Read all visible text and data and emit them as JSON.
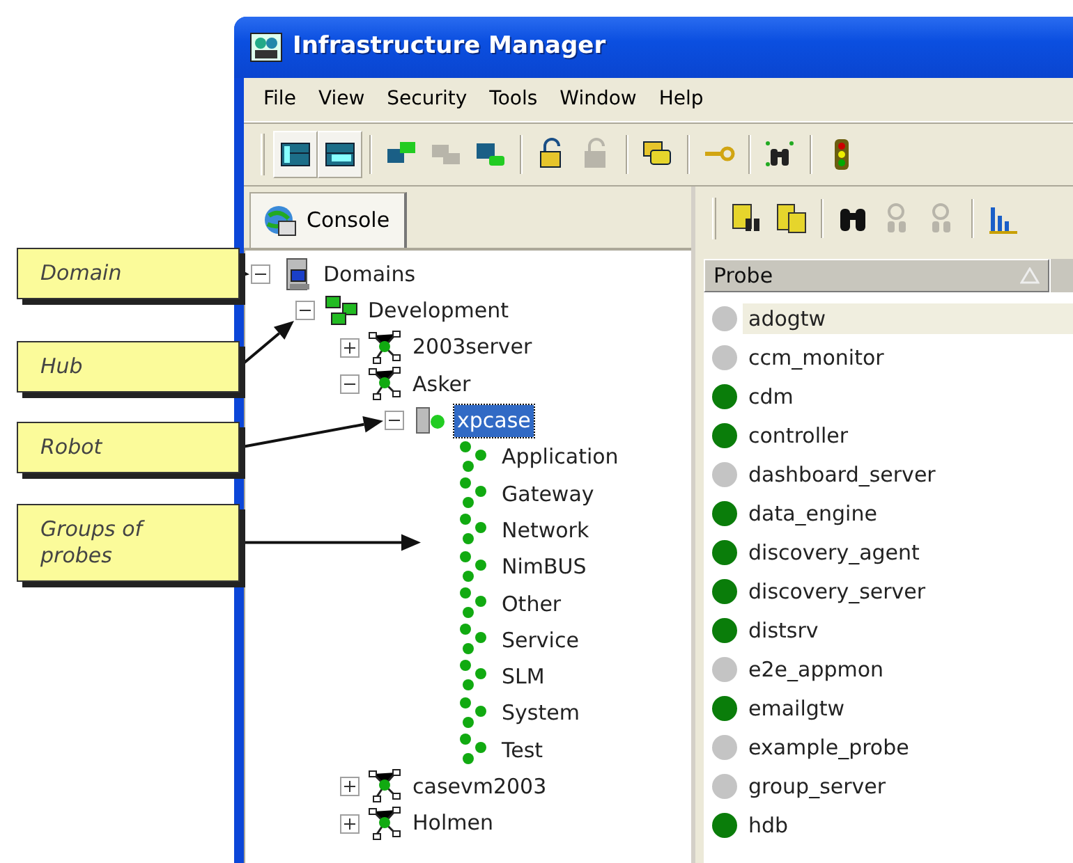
{
  "window": {
    "title": "Infrastructure Manager"
  },
  "menu": [
    "File",
    "View",
    "Security",
    "Tools",
    "Window",
    "Help"
  ],
  "main_toolbar": [
    [
      {
        "disabled": false,
        "pressed": true
      },
      {
        "disabled": false,
        "pressed": true
      }
    ],
    [
      {
        "disabled": false,
        "pressed": false
      },
      {
        "disabled": true,
        "pressed": false
      },
      {
        "disabled": false,
        "pressed": false
      }
    ],
    [
      {
        "disabled": false,
        "pressed": false
      },
      {
        "disabled": true,
        "pressed": false
      }
    ],
    [
      {
        "disabled": false,
        "pressed": false
      }
    ],
    [
      {
        "disabled": false,
        "pressed": false
      }
    ],
    [
      {
        "disabled": false,
        "pressed": false
      }
    ],
    [
      {
        "disabled": false,
        "pressed": false
      }
    ]
  ],
  "tabs": [
    {
      "label": "Console",
      "selected": true
    }
  ],
  "tree": [
    {
      "label": "Domains",
      "kind": "domain",
      "expanded": true,
      "selected": false,
      "callout": "Domain",
      "children": [
        {
          "label": "Development",
          "kind": "hub",
          "expanded": true,
          "selected": false,
          "callout": "Hub",
          "children": [
            {
              "label": "2003server",
              "kind": "server",
              "expanded": false,
              "selected": false
            },
            {
              "label": "Asker",
              "kind": "server",
              "expanded": true,
              "selected": false,
              "children": [
                {
                  "label": "xpcase",
                  "kind": "robot",
                  "expanded": true,
                  "selected": true,
                  "callout": "Robot",
                  "children": [
                    {
                      "label": "Application",
                      "kind": "group",
                      "selected": false
                    },
                    {
                      "label": "Gateway",
                      "kind": "group",
                      "selected": false
                    },
                    {
                      "label": "Network",
                      "kind": "group",
                      "selected": false,
                      "callout": "Groups of probes"
                    },
                    {
                      "label": "NimBUS",
                      "kind": "group",
                      "selected": false
                    },
                    {
                      "label": "Other",
                      "kind": "group",
                      "selected": false
                    },
                    {
                      "label": "Service",
                      "kind": "group",
                      "selected": false
                    },
                    {
                      "label": "SLM",
                      "kind": "group",
                      "selected": false
                    },
                    {
                      "label": "System",
                      "kind": "group",
                      "selected": false
                    },
                    {
                      "label": "Test",
                      "kind": "group",
                      "selected": false
                    }
                  ]
                }
              ]
            },
            {
              "label": "casevm2003",
              "kind": "server",
              "expanded": false,
              "selected": false
            },
            {
              "label": "Holmen",
              "kind": "server",
              "expanded": false,
              "selected": false
            }
          ]
        }
      ]
    }
  ],
  "probe_toolbar": [
    [
      {
        "disabled": false
      },
      {
        "disabled": false
      }
    ],
    [
      {
        "disabled": false
      },
      {
        "disabled": true
      },
      {
        "disabled": true
      }
    ],
    [
      {
        "disabled": false
      }
    ]
  ],
  "probe_list": {
    "columns": [
      "Probe"
    ],
    "rows": [
      {
        "name": "adogtw",
        "color": "#c4c4c4",
        "selected": true
      },
      {
        "name": "ccm_monitor",
        "color": "#c4c4c4",
        "selected": false
      },
      {
        "name": "cdm",
        "color": "#0a7d0a",
        "selected": false
      },
      {
        "name": "controller",
        "color": "#0a7d0a",
        "selected": false
      },
      {
        "name": "dashboard_server",
        "color": "#c4c4c4",
        "selected": false
      },
      {
        "name": "data_engine",
        "color": "#0a7d0a",
        "selected": false
      },
      {
        "name": "discovery_agent",
        "color": "#0a7d0a",
        "selected": false
      },
      {
        "name": "discovery_server",
        "color": "#0a7d0a",
        "selected": false
      },
      {
        "name": "distsrv",
        "color": "#0a7d0a",
        "selected": false
      },
      {
        "name": "e2e_appmon",
        "color": "#c4c4c4",
        "selected": false
      },
      {
        "name": "emailgtw",
        "color": "#0a7d0a",
        "selected": false
      },
      {
        "name": "example_probe",
        "color": "#c4c4c4",
        "selected": false
      },
      {
        "name": "group_server",
        "color": "#c4c4c4",
        "selected": false
      },
      {
        "name": "hdb",
        "color": "#0a7d0a",
        "selected": false
      }
    ]
  }
}
